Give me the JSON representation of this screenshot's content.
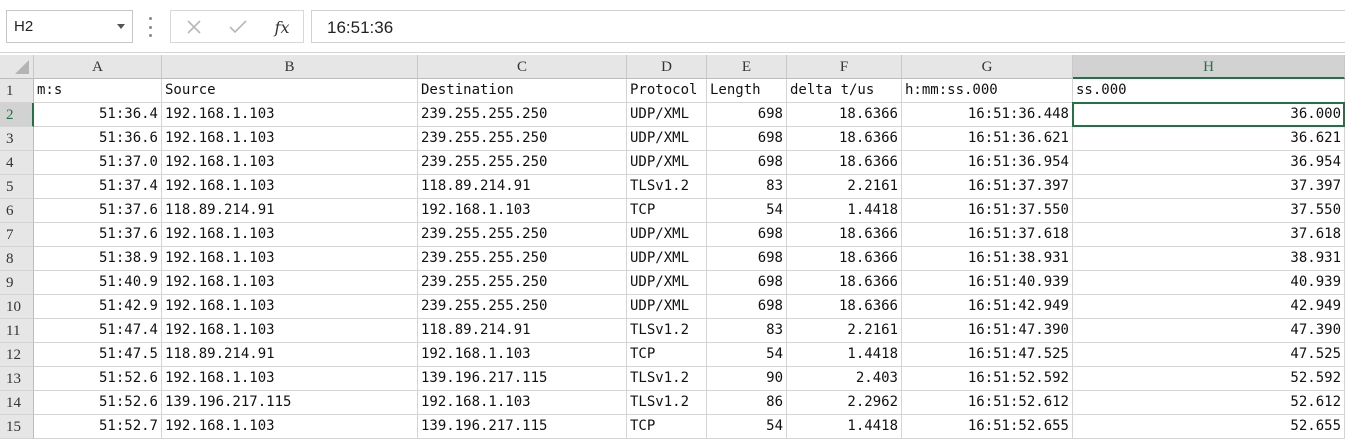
{
  "formula_bar": {
    "name_box": "H2",
    "formula": "16:51:36",
    "fx_label": "fx"
  },
  "sheet": {
    "columns": [
      "A",
      "B",
      "C",
      "D",
      "E",
      "F",
      "G",
      "H"
    ],
    "selected_column": "H",
    "selected_row": "2",
    "row_numbers": [
      "1",
      "2",
      "3",
      "4",
      "5",
      "6",
      "7",
      "8",
      "9",
      "10",
      "11",
      "12",
      "13",
      "14",
      "15"
    ],
    "headers": [
      "m:s",
      "Source",
      "Destination",
      "Protocol",
      "Length",
      "delta t/us",
      "h:mm:ss.000",
      "ss.000"
    ],
    "rows": [
      [
        "51:36.4",
        "192.168.1.103",
        "239.255.255.250",
        "UDP/XML",
        "698",
        "18.6366",
        "16:51:36.448",
        "36.000"
      ],
      [
        "51:36.6",
        "192.168.1.103",
        "239.255.255.250",
        "UDP/XML",
        "698",
        "18.6366",
        "16:51:36.621",
        "36.621"
      ],
      [
        "51:37.0",
        "192.168.1.103",
        "239.255.255.250",
        "UDP/XML",
        "698",
        "18.6366",
        "16:51:36.954",
        "36.954"
      ],
      [
        "51:37.4",
        "192.168.1.103",
        "118.89.214.91",
        "TLSv1.2",
        "83",
        "2.2161",
        "16:51:37.397",
        "37.397"
      ],
      [
        "51:37.6",
        "118.89.214.91",
        "192.168.1.103",
        "TCP",
        "54",
        "1.4418",
        "16:51:37.550",
        "37.550"
      ],
      [
        "51:37.6",
        "192.168.1.103",
        "239.255.255.250",
        "UDP/XML",
        "698",
        "18.6366",
        "16:51:37.618",
        "37.618"
      ],
      [
        "51:38.9",
        "192.168.1.103",
        "239.255.255.250",
        "UDP/XML",
        "698",
        "18.6366",
        "16:51:38.931",
        "38.931"
      ],
      [
        "51:40.9",
        "192.168.1.103",
        "239.255.255.250",
        "UDP/XML",
        "698",
        "18.6366",
        "16:51:40.939",
        "40.939"
      ],
      [
        "51:42.9",
        "192.168.1.103",
        "239.255.255.250",
        "UDP/XML",
        "698",
        "18.6366",
        "16:51:42.949",
        "42.949"
      ],
      [
        "51:47.4",
        "192.168.1.103",
        "118.89.214.91",
        "TLSv1.2",
        "83",
        "2.2161",
        "16:51:47.390",
        "47.390"
      ],
      [
        "51:47.5",
        "118.89.214.91",
        "192.168.1.103",
        "TCP",
        "54",
        "1.4418",
        "16:51:47.525",
        "47.525"
      ],
      [
        "51:52.6",
        "192.168.1.103",
        "139.196.217.115",
        "TLSv1.2",
        "90",
        "2.403",
        "16:51:52.592",
        "52.592"
      ],
      [
        "51:52.6",
        "139.196.217.115",
        "192.168.1.103",
        "TLSv1.2",
        "86",
        "2.2962",
        "16:51:52.612",
        "52.612"
      ],
      [
        "51:52.7",
        "192.168.1.103",
        "139.196.217.115",
        "TCP",
        "54",
        "1.4418",
        "16:51:52.655",
        "52.655"
      ]
    ]
  }
}
